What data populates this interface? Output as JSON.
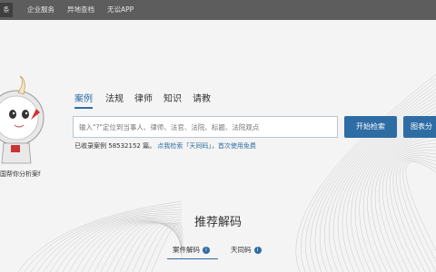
{
  "topbar": {
    "home_label": "条",
    "links": [
      "企业服务",
      "异地查档",
      "无讼APP"
    ]
  },
  "mascot": {
    "slogan": "国帮你分析案f"
  },
  "tabs": [
    "案例",
    "法规",
    "律师",
    "知识",
    "请教"
  ],
  "search": {
    "placeholder": "输入\"?\"定位到当事人、律师、法官、法院、标题、法院观点",
    "submit_label": "开始检索",
    "chart_label": "图表分"
  },
  "stats": {
    "prefix": "已收录案例",
    "count": "58532152",
    "unit": "篇。",
    "link_text": "点我检索「天同码」，首次使用免费"
  },
  "section": {
    "title": "推荐解码",
    "subtabs": [
      "案件解码",
      "天同码"
    ]
  },
  "colors": {
    "accent": "#2e6da4",
    "topbar": "#5d5d5d"
  }
}
